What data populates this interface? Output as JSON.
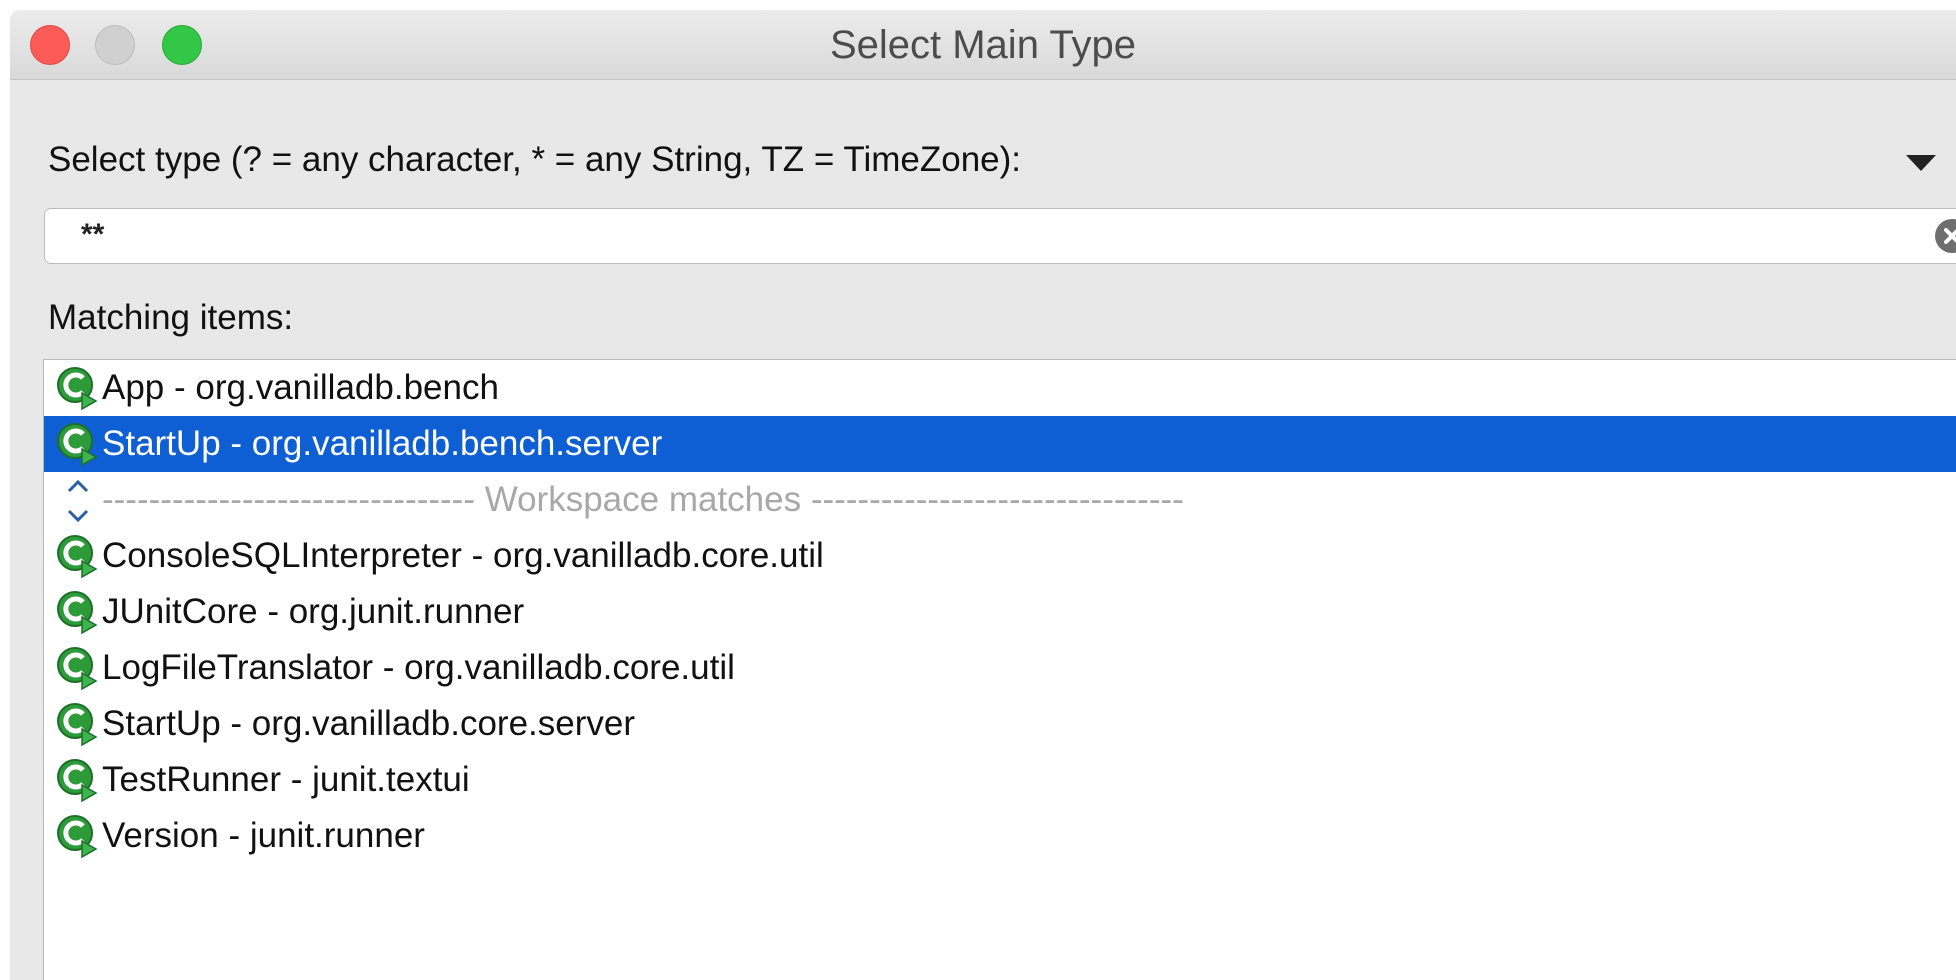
{
  "window": {
    "title": "Select Main Type"
  },
  "prompt": {
    "label": "Select type (? = any character, * = any String, TZ = TimeZone):"
  },
  "search": {
    "value": "**",
    "clear_icon": "clear-circle-icon"
  },
  "matching": {
    "label": "Matching items:"
  },
  "history_items": [
    {
      "label": "App - org.vanilladb.bench",
      "selected": false
    },
    {
      "label": "StartUp - org.vanilladb.bench.server",
      "selected": true
    }
  ],
  "separator": {
    "label": "-------------------------------- Workspace matches --------------------------------"
  },
  "workspace_items": [
    {
      "label": "ConsoleSQLInterpreter - org.vanilladb.core.util"
    },
    {
      "label": "JUnitCore - org.junit.runner"
    },
    {
      "label": "LogFileTranslator - org.vanilladb.core.util"
    },
    {
      "label": "StartUp - org.vanilladb.core.server"
    },
    {
      "label": "TestRunner - junit.textui"
    },
    {
      "label": "Version - junit.runner"
    }
  ],
  "colors": {
    "selection": "#0d5fd3",
    "icon_green": "#2e9b3a",
    "separator_text": "#a8a8a8"
  }
}
